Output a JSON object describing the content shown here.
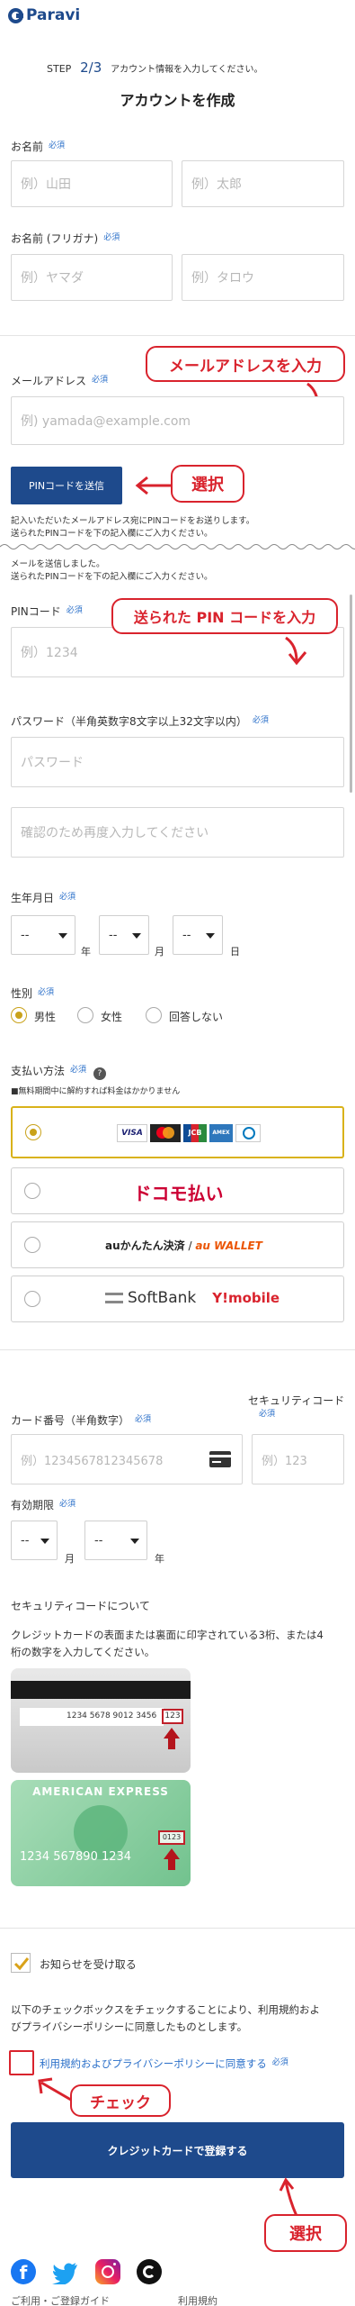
{
  "header": {
    "logo": "Paravi"
  },
  "step": {
    "label": "STEP",
    "num": "2/3",
    "text": "アカウント情報を入力してください。"
  },
  "page_title": "アカウントを作成",
  "required": "必須",
  "name": {
    "label": "お名前",
    "last_ph": "例）山田",
    "first_ph": "例）太郎"
  },
  "kana": {
    "label": "お名前 (フリガナ)",
    "last_ph": "例）ヤマダ",
    "first_ph": "例）タロウ"
  },
  "email": {
    "label": "メールアドレス",
    "placeholder": "例) yamada@example.com"
  },
  "callouts": {
    "email": "メールアドレスを入力",
    "select1": "選択",
    "pin": "送られた PIN コードを入力",
    "check": "チェック",
    "select2": "選択"
  },
  "pin_button": "PINコードを送信",
  "pin_notice": [
    "記入いただいたメールアドレス宛にPINコードをお送りします。",
    "送られたPINコードを下の記入欄にご入力ください。"
  ],
  "sent_notice": [
    "メールを送信しました。",
    "送られたPINコードを下の記入欄にご入力ください。"
  ],
  "pin": {
    "label": "PINコード",
    "placeholder": "例）1234"
  },
  "password": {
    "label": "パスワード（半角英数字8文字以上32文字以内）",
    "placeholder": "パスワード",
    "confirm_ph": "確認のため再度入力してください"
  },
  "birth": {
    "label": "生年月日",
    "year_val": "--",
    "year_unit": "年",
    "month_val": "--",
    "month_unit": "月",
    "day_val": "--",
    "day_unit": "日"
  },
  "gender": {
    "label": "性別",
    "male": "男性",
    "female": "女性",
    "none": "回答しない"
  },
  "payment": {
    "label": "支払い方法",
    "note": "■無料期間中に解約すれば料金はかかりません",
    "docomo": "ドコモ払い",
    "au_a": "auかんたん決済",
    "au_sep": " / ",
    "au_b": "au WALLET",
    "softbank": "SoftBank",
    "ymobile": "Y!mobile",
    "cards": [
      "VISA",
      "MC",
      "JCB",
      "AMEX",
      "Diners"
    ]
  },
  "card": {
    "label": "カード番号（半角数字）",
    "placeholder": "例）1234567812345678",
    "sec_label": "セキュリティコード",
    "sec_ph": "例）123"
  },
  "expiry": {
    "label": "有効期限",
    "month_val": "--",
    "month_unit": "月",
    "year_val": "--",
    "year_unit": "年"
  },
  "security": {
    "title": "セキュリティコードについて",
    "desc": [
      "クレジットカードの表面または裏面に印字されている3桁、または4",
      "桁の数字を入力してください。"
    ],
    "card1_num": "1234 5678 9012 3456",
    "card1_code": "123",
    "card2_brand": "AMERICAN EXPRESS",
    "card2_code": "0123",
    "card2_num": "1234  567890  1234"
  },
  "newsletter": "お知らせを受け取る",
  "agree_notice": [
    "以下のチェックボックスをチェックすることにより、利用規約およ",
    "びプライバシーポリシーに同意したものとします。"
  ],
  "agree_label": "利用規約およびプライバシーポリシーに同意する",
  "submit": "クレジットカードで登録する",
  "footer": {
    "guide": "ご利用・ご登録ガイド",
    "terms": "利用規約"
  },
  "colors": {
    "brand_blue": "#1e4a8c",
    "callout_red": "#d9232d",
    "check_gold": "#d9a21a",
    "link_blue": "#2a6fc9"
  }
}
